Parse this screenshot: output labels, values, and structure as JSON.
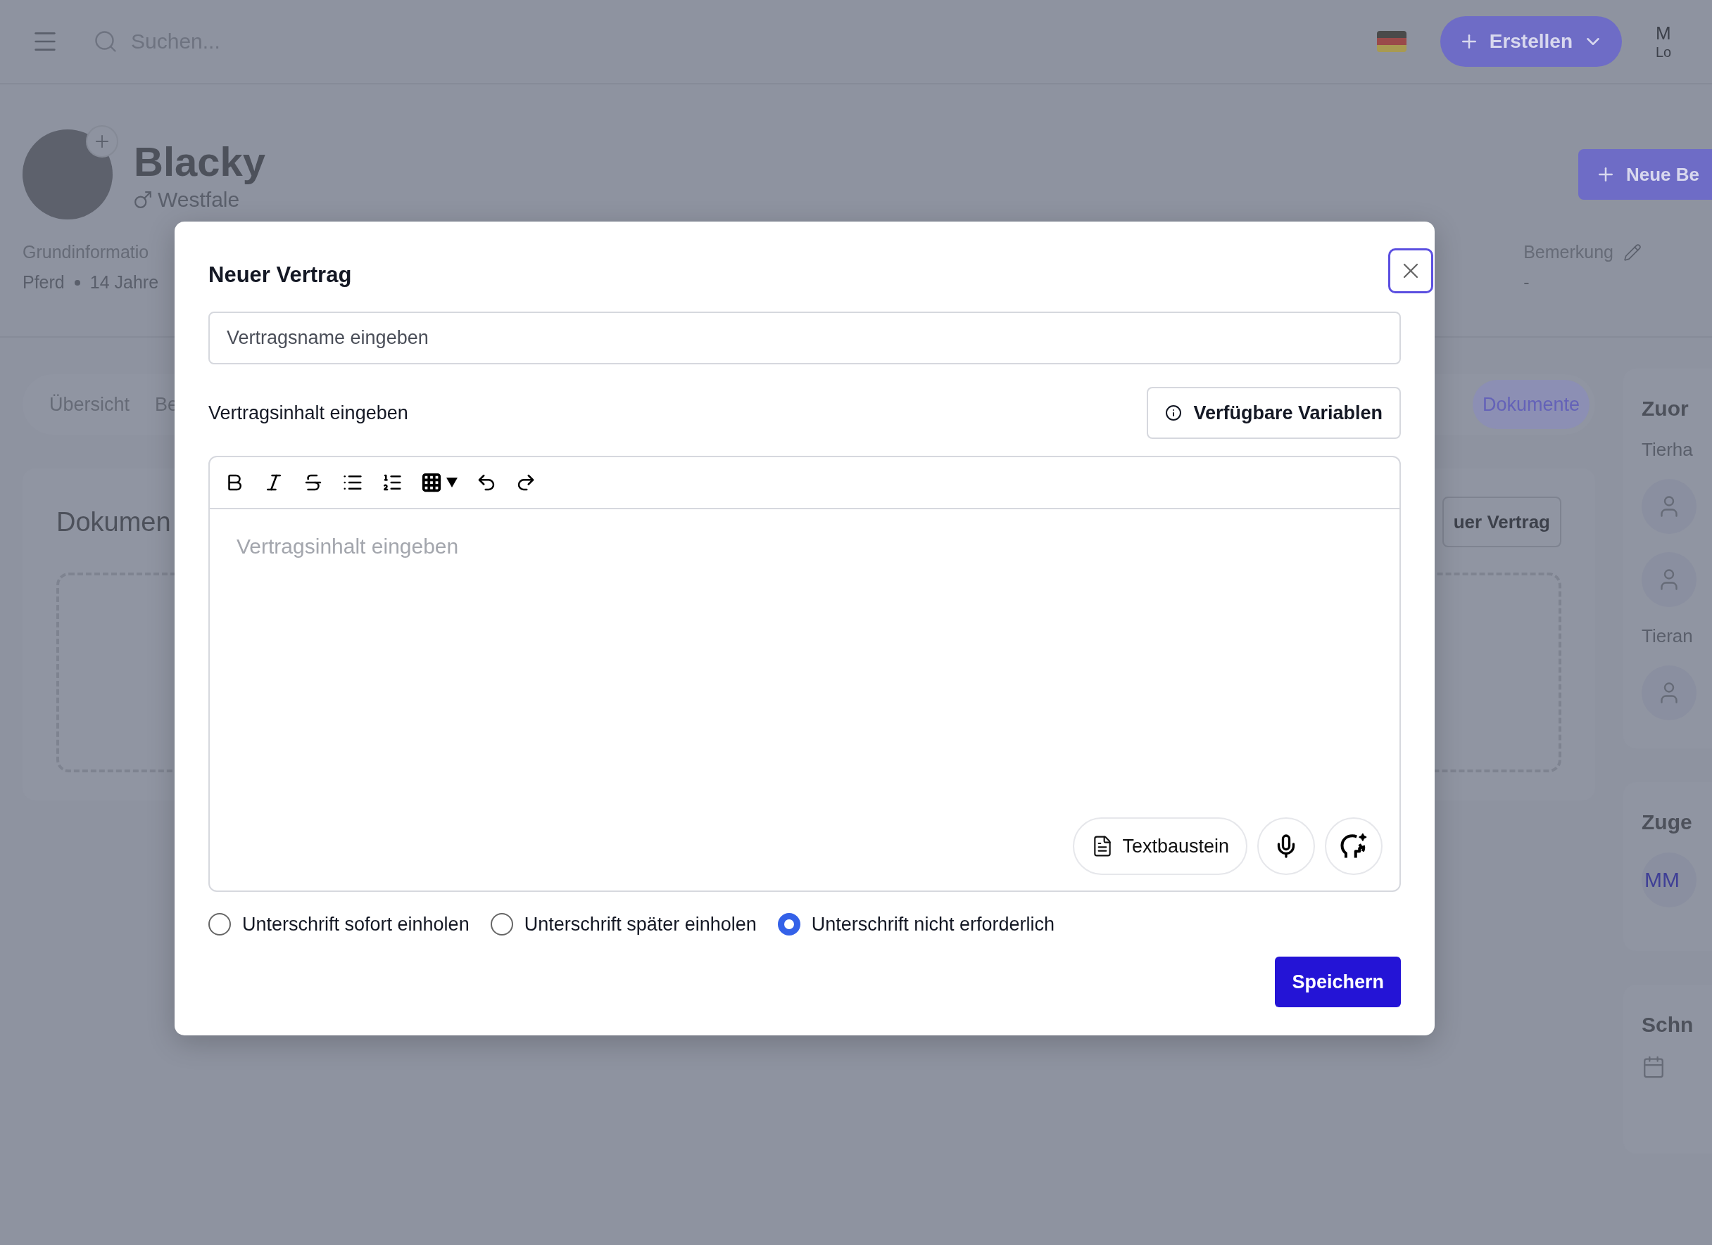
{
  "top_bar": {
    "search": {
      "placeholder": "Suchen..."
    },
    "create_button": "Erstellen",
    "user": {
      "name": "M",
      "subtitle": "Lo"
    }
  },
  "animal": {
    "name": "Blacky",
    "breed": "Westfale",
    "new_button": "Neue Be"
  },
  "info": {
    "heading": "Grundinformatio",
    "species": "Pferd",
    "age": "14 Jahre",
    "remark_label": "Bemerkung",
    "remark_value": "-"
  },
  "tabs": [
    {
      "label": "Übersicht",
      "selected": false
    },
    {
      "label": "Be",
      "selected": false
    },
    {
      "label": "Dokumente",
      "selected": true
    }
  ],
  "documents": {
    "title": "Dokumen",
    "button": "uer Vertrag"
  },
  "side_cards": [
    {
      "title": "Zuor",
      "items": [
        {
          "kind": "label",
          "text": "Tierha"
        },
        {
          "kind": "person"
        },
        {
          "kind": "person"
        },
        {
          "kind": "label",
          "text": "Tieran"
        },
        {
          "kind": "person"
        }
      ]
    },
    {
      "title": "Zuge",
      "items": [
        {
          "kind": "initials",
          "text": "MM"
        }
      ]
    },
    {
      "title": "Schn",
      "items": [
        {
          "kind": "calendar"
        }
      ]
    }
  ],
  "modal": {
    "title": "Neuer Vertrag",
    "name_field": {
      "placeholder": "Vertragsname eingeben"
    },
    "content_label": "Vertragsinhalt eingeben",
    "variables_button": "Verfügbare Variablen",
    "editor": {
      "placeholder": "Vertragsinhalt eingeben",
      "toolbar": [
        {
          "kind": "bold"
        },
        {
          "kind": "italic"
        },
        {
          "kind": "strike"
        },
        {
          "kind": "bullet-list"
        },
        {
          "kind": "numbered-list"
        },
        {
          "kind": "table"
        },
        {
          "kind": "undo"
        },
        {
          "kind": "redo"
        }
      ]
    },
    "snippet_button": "Textbaustein",
    "signature_options": [
      {
        "label": "Unterschrift sofort einholen",
        "selected": false
      },
      {
        "label": "Unterschrift später einholen",
        "selected": false
      },
      {
        "label": "Unterschrift nicht erforderlich",
        "selected": true
      }
    ],
    "save_button": "Speichern"
  }
}
